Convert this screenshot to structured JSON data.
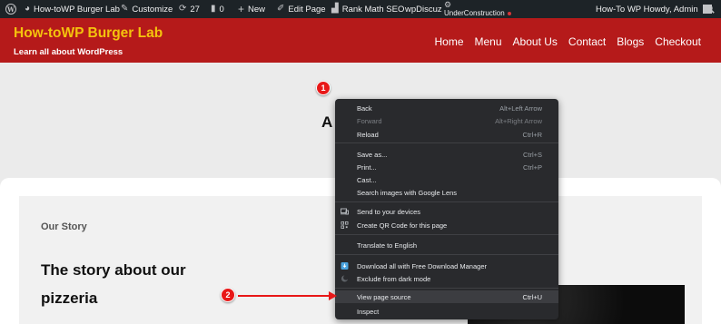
{
  "admin_bar": {
    "site_name": "How-toWP Burger Lab",
    "customize": "Customize",
    "updates_count": "27",
    "comments_count": "0",
    "new_label": "New",
    "edit_page": "Edit Page",
    "seo": "Rank Math SEO",
    "discuz": "wpDiscuz",
    "under_construction": "UnderConstruction",
    "howdy": "How-To WP Howdy, Admin"
  },
  "site": {
    "title": "How-toWP Burger Lab",
    "tagline": "Learn all about WordPress",
    "nav": [
      "Home",
      "Menu",
      "About Us",
      "Contact",
      "Blogs",
      "Checkout"
    ]
  },
  "page": {
    "heading_partial": "A",
    "story_eyebrow": "Our Story",
    "story_heading": "The story about our pizzeria"
  },
  "context_menu": {
    "items": [
      {
        "label": "Back",
        "shortcut": "Alt+Left Arrow"
      },
      {
        "label": "Forward",
        "shortcut": "Alt+Right Arrow",
        "disabled": true
      },
      {
        "label": "Reload",
        "shortcut": "Ctrl+R"
      },
      {
        "label": "Save as...",
        "shortcut": "Ctrl+S"
      },
      {
        "label": "Print...",
        "shortcut": "Ctrl+P"
      },
      {
        "label": "Cast...",
        "shortcut": ""
      },
      {
        "label": "Search images with Google Lens",
        "shortcut": ""
      },
      {
        "label": "Send to your devices",
        "shortcut": "",
        "icon": "devices-icon"
      },
      {
        "label": "Create QR Code for this page",
        "shortcut": "",
        "icon": "qr-code-icon"
      },
      {
        "label": "Translate to English",
        "shortcut": ""
      },
      {
        "label": "Download all with Free Download Manager",
        "shortcut": "",
        "icon": "download-manager-icon"
      },
      {
        "label": "Exclude from dark mode",
        "shortcut": "",
        "icon": "dark-mode-icon"
      },
      {
        "label": "View page source",
        "shortcut": "Ctrl+U",
        "highlighted": true
      },
      {
        "label": "Inspect",
        "shortcut": ""
      }
    ]
  },
  "annotations": {
    "badge_1": "1",
    "badge_2": "2"
  },
  "colors": {
    "admin_bar": "#1d2327",
    "header_red": "#b51a1a",
    "title_yellow": "#f4c20d",
    "menu_bg": "#292a2d",
    "annotation_red": "#e81818"
  }
}
